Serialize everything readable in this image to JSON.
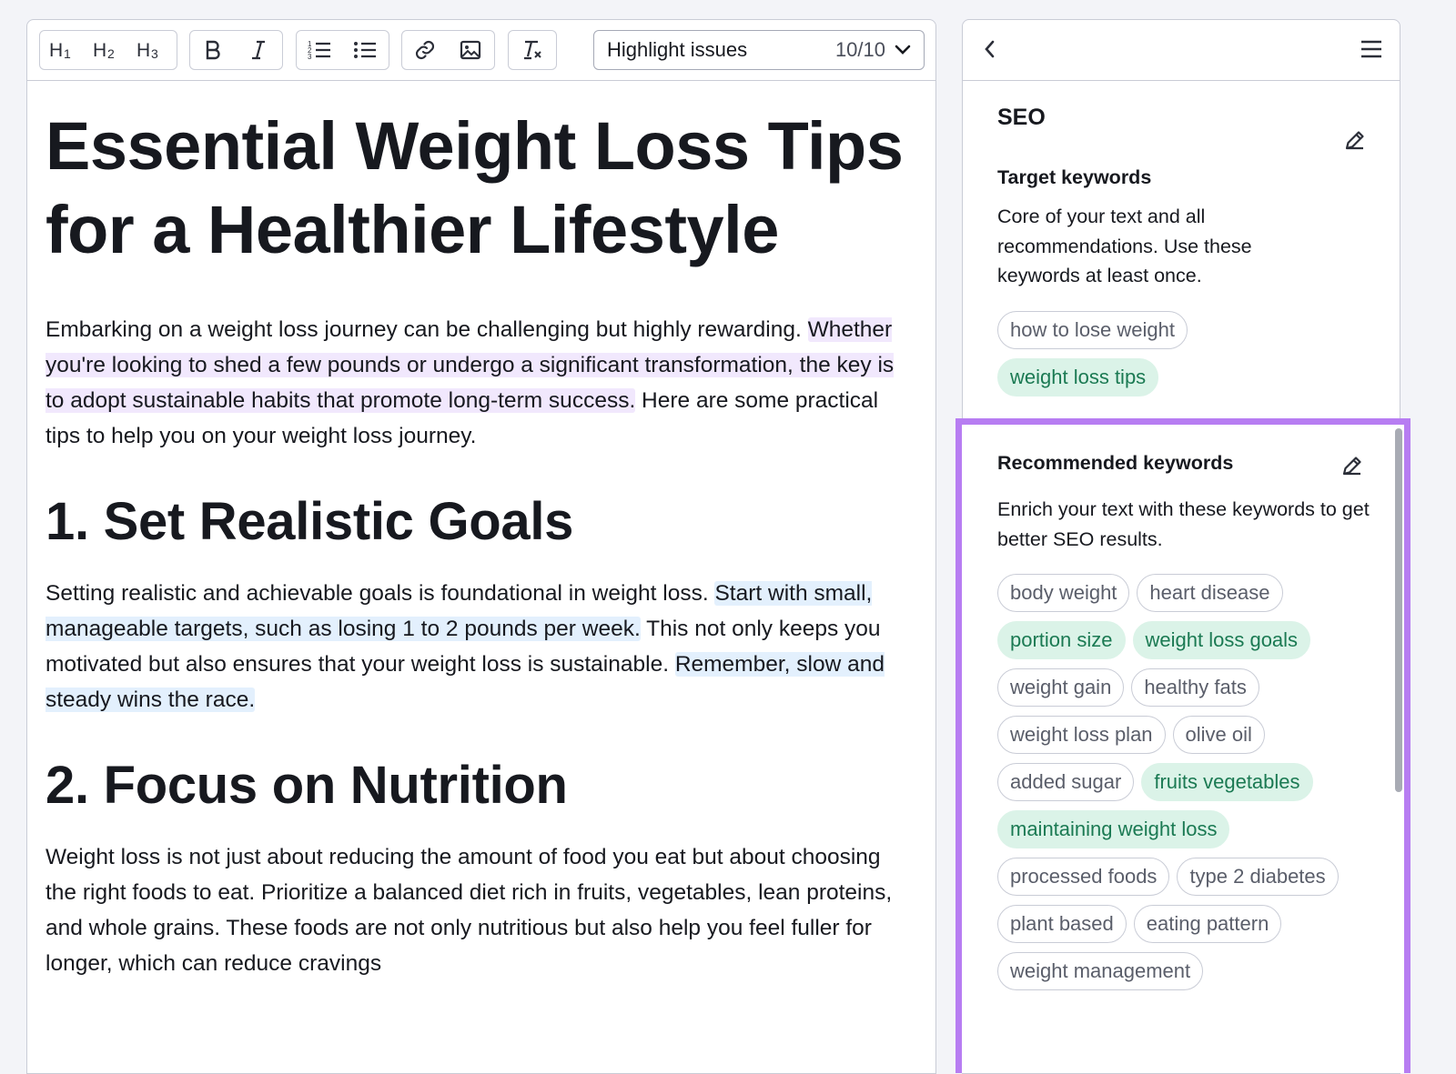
{
  "toolbar": {
    "h1": "H1",
    "h2": "H2",
    "h3": "H3",
    "highlight_label": "Highlight issues",
    "highlight_count": "10/10"
  },
  "article": {
    "title": "Essential Weight Loss Tips for a Healthier Lifestyle",
    "p1_a": "Embarking on a weight loss journey can be challenging but highly rewarding. ",
    "p1_b": "Whether you're looking to shed a few pounds or undergo a significant transformation, the key is to adopt sustainable habits that promote long-term success.",
    "p1_c": " Here are some practical tips to help you on your weight loss journey.",
    "h2_1": "1. Set Realistic Goals",
    "p2_a": "Setting realistic and achievable goals is foundational in weight loss. ",
    "p2_b": "Start with small, manageable targets, such as losing 1 to 2 pounds per week.",
    "p2_c": " This not only keeps you motivated but also ensures that your weight loss is sustainable. ",
    "p2_d": "Remember, slow and steady wins the race.",
    "h2_2": "2. Focus on Nutrition",
    "p3": "Weight loss is not just about reducing the amount of food you eat but about choosing the right foods to eat. Prioritize a balanced diet rich in fruits, vegetables, lean proteins, and whole grains. These foods are not only nutritious but also help you feel fuller for longer, which can reduce cravings"
  },
  "sidebar": {
    "seo_title": "SEO",
    "target": {
      "heading": "Target keywords",
      "description": "Core of your text and all recommendations. Use these keywords at least once.",
      "keywords": [
        {
          "text": "how to lose weight",
          "used": false
        },
        {
          "text": "weight loss tips",
          "used": true
        }
      ]
    },
    "recommended": {
      "heading": "Recommended keywords",
      "description": "Enrich your text with these keywords to get better SEO results.",
      "keywords": [
        {
          "text": "body weight",
          "used": false
        },
        {
          "text": "heart disease",
          "used": false
        },
        {
          "text": "portion size",
          "used": true
        },
        {
          "text": "weight loss goals",
          "used": true
        },
        {
          "text": "weight gain",
          "used": false
        },
        {
          "text": "healthy fats",
          "used": false
        },
        {
          "text": "weight loss plan",
          "used": false
        },
        {
          "text": "olive oil",
          "used": false
        },
        {
          "text": "added sugar",
          "used": false
        },
        {
          "text": "fruits vegetables",
          "used": true
        },
        {
          "text": "maintaining weight loss",
          "used": true
        },
        {
          "text": "processed foods",
          "used": false
        },
        {
          "text": "type 2 diabetes",
          "used": false
        },
        {
          "text": "plant based",
          "used": false
        },
        {
          "text": "eating pattern",
          "used": false
        },
        {
          "text": "weight management",
          "used": false
        }
      ]
    }
  },
  "colors": {
    "highlight_box": "#b77df2",
    "used_keyword_bg": "#dbf3e8",
    "used_keyword_text": "#1b7a53",
    "purple_highlight": "#f1e8fd",
    "blue_highlight": "#e3f0fd"
  }
}
